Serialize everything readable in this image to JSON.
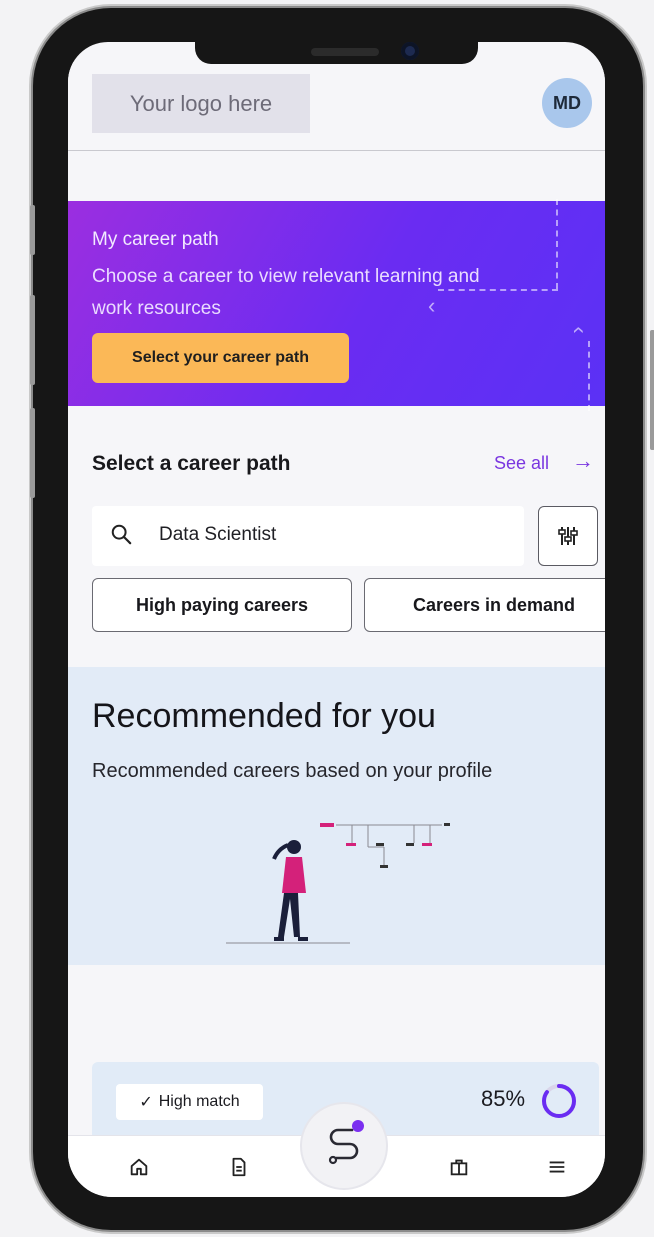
{
  "header": {
    "logo_text": "Your logo here",
    "avatar_initials": "MD"
  },
  "hero": {
    "title": "My career path",
    "description": "Choose a career to view relevant learning and work resources",
    "button_label": "Select your career path",
    "gradient_colors": [
      "#9b2ee0",
      "#5b31f5"
    ],
    "button_color": "#fbb857"
  },
  "career_path": {
    "title": "Select a career path",
    "see_all": "See all",
    "search_value": "Data Scientist",
    "chips": [
      "High paying careers",
      "Careers in demand"
    ]
  },
  "recommended": {
    "title": "Recommended for you",
    "subtitle": "Recommended careers based on your profile"
  },
  "card": {
    "badge": "High match",
    "match_percent": "85%",
    "match_value": 0.85
  },
  "nav": {
    "items": [
      "home-icon",
      "document-icon",
      "career-path-icon",
      "briefcase-icon",
      "menu-icon"
    ],
    "accent": "#7b2ff0"
  }
}
